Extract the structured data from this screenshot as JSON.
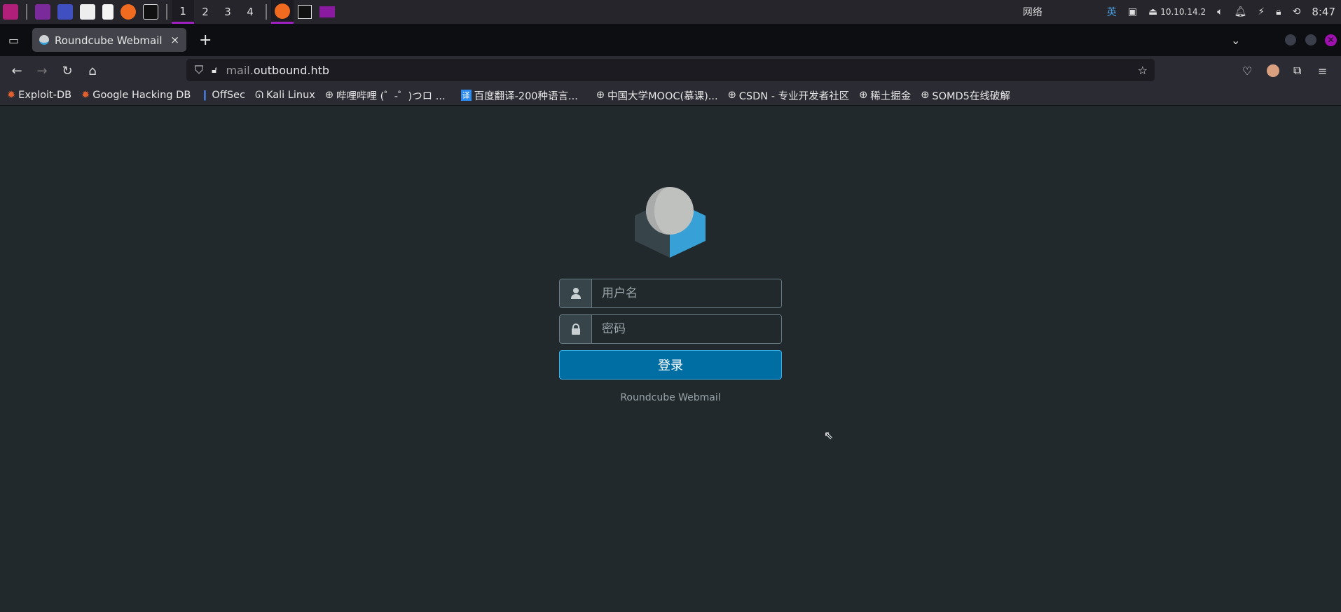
{
  "taskbar": {
    "workspaces": [
      "1",
      "2",
      "3",
      "4"
    ],
    "active_workspace": "1",
    "network_label": "网络",
    "ime": "英",
    "ip": "10.10.14.2",
    "time": "8:47"
  },
  "browser": {
    "tab_title": "Roundcube Webmail :: 欢",
    "url_host_prefix": "mail.",
    "url_domain": "outbound.htb",
    "bookmarks": [
      "Exploit-DB",
      "Google Hacking DB",
      "OffSec",
      "Kali Linux",
      "哔哩哔哩 (゜-゜)つロ ...",
      "百度翻译-200种语言...",
      "中国大学MOOC(慕课)...",
      "CSDN - 专业开发者社区",
      "稀土掘金",
      "SOMD5在线破解"
    ]
  },
  "login": {
    "username_placeholder": "用户名",
    "password_placeholder": "密码",
    "submit_label": "登录",
    "footer": "Roundcube Webmail"
  },
  "colors": {
    "accent": "#006ea3",
    "background": "#21292d",
    "logo_blue": "#37a0d6"
  }
}
